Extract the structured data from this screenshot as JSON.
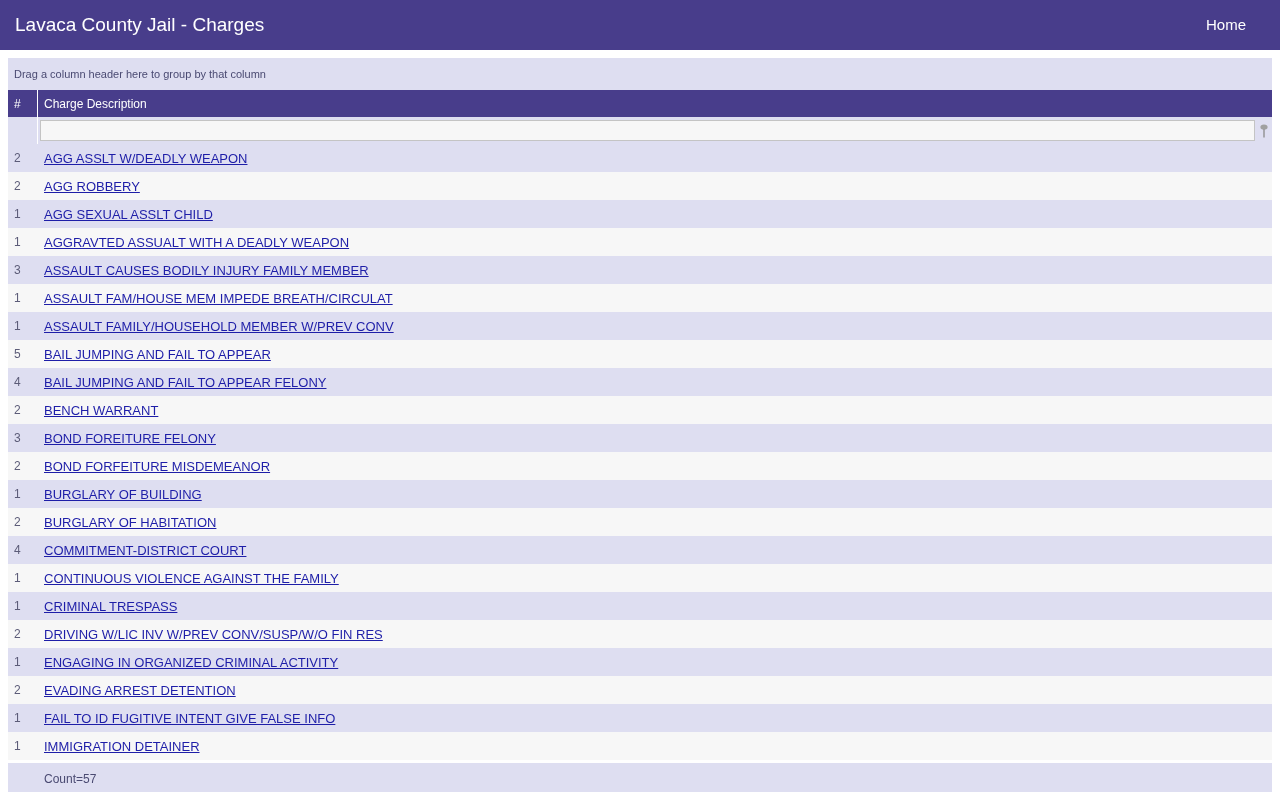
{
  "header": {
    "title": "Lavaca County Jail - Charges",
    "nav": [
      {
        "label": "Home"
      }
    ]
  },
  "grid": {
    "group_panel": "Drag a column header here to group by that column",
    "columns": [
      "#",
      "Charge Description"
    ],
    "rows": [
      {
        "count": "2",
        "charge": "AGG ASSLT W/DEADLY WEAPON"
      },
      {
        "count": "2",
        "charge": "AGG ROBBERY"
      },
      {
        "count": "1",
        "charge": "AGG SEXUAL ASSLT CHILD"
      },
      {
        "count": "1",
        "charge": "AGGRAVTED ASSUALT WITH A DEADLY WEAPON"
      },
      {
        "count": "3",
        "charge": "ASSAULT CAUSES BODILY INJURY FAMILY MEMBER"
      },
      {
        "count": "1",
        "charge": "ASSAULT FAM/HOUSE MEM IMPEDE BREATH/CIRCULAT"
      },
      {
        "count": "1",
        "charge": "ASSAULT FAMILY/HOUSEHOLD MEMBER W/PREV CONV"
      },
      {
        "count": "5",
        "charge": "BAIL JUMPING AND FAIL TO APPEAR"
      },
      {
        "count": "4",
        "charge": "BAIL JUMPING AND FAIL TO APPEAR FELONY"
      },
      {
        "count": "2",
        "charge": "BENCH WARRANT"
      },
      {
        "count": "3",
        "charge": "BOND FOREITURE FELONY"
      },
      {
        "count": "2",
        "charge": "BOND FORFEITURE MISDEMEANOR"
      },
      {
        "count": "1",
        "charge": "BURGLARY OF BUILDING"
      },
      {
        "count": "2",
        "charge": "BURGLARY OF HABITATION"
      },
      {
        "count": "4",
        "charge": "COMMITMENT-DISTRICT COURT"
      },
      {
        "count": "1",
        "charge": "CONTINUOUS VIOLENCE AGAINST THE FAMILY"
      },
      {
        "count": "1",
        "charge": "CRIMINAL TRESPASS"
      },
      {
        "count": "2",
        "charge": "DRIVING W/LIC INV W/PREV CONV/SUSP/W/O FIN RES"
      },
      {
        "count": "1",
        "charge": "ENGAGING IN ORGANIZED CRIMINAL ACTIVITY"
      },
      {
        "count": "2",
        "charge": "EVADING ARREST DETENTION"
      },
      {
        "count": "1",
        "charge": "FAIL TO ID FUGITIVE INTENT GIVE FALSE INFO"
      },
      {
        "count": "1",
        "charge": "IMMIGRATION DETAINER"
      }
    ],
    "footer": "Count=57"
  }
}
